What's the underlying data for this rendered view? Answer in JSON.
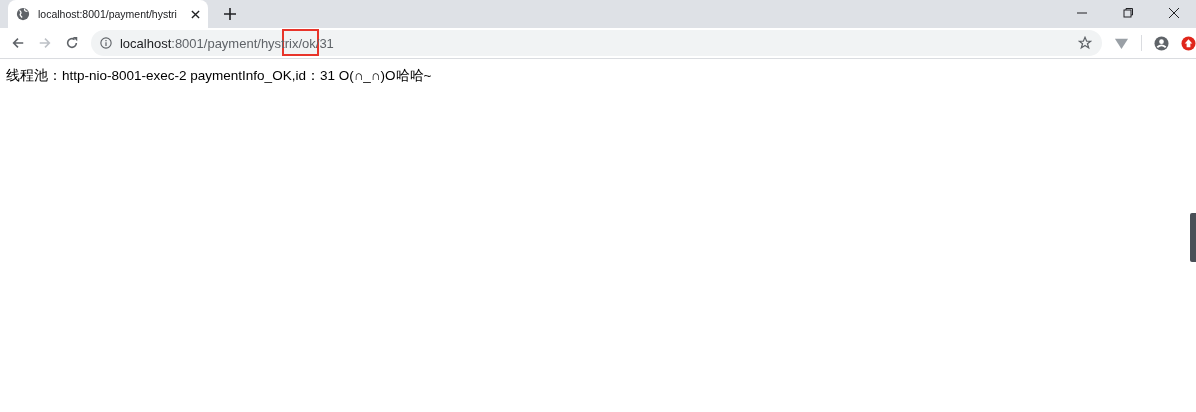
{
  "tab": {
    "title": "localhost:8001/payment/hystri",
    "selected": true
  },
  "address_bar": {
    "host": "localhost",
    "path": ":8001/payment/hystrix/ok/31"
  },
  "page": {
    "text": "线程池：http-nio-8001-exec-2 paymentInfo_OK,id：31 O(∩_∩)O哈哈~"
  }
}
